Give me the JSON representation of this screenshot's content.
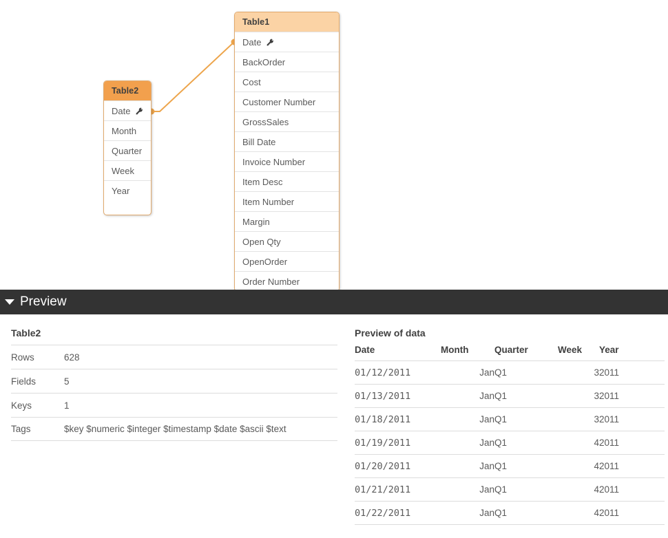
{
  "canvas": {
    "tables": [
      {
        "name": "Table1",
        "fields": [
          {
            "label": "Date",
            "key": true
          },
          {
            "label": "BackOrder",
            "key": false
          },
          {
            "label": "Cost",
            "key": false
          },
          {
            "label": "Customer Number",
            "key": false
          },
          {
            "label": "GrossSales",
            "key": false
          },
          {
            "label": "Bill Date",
            "key": false
          },
          {
            "label": "Invoice Number",
            "key": false
          },
          {
            "label": "Item Desc",
            "key": false
          },
          {
            "label": "Item Number",
            "key": false
          },
          {
            "label": "Margin",
            "key": false
          },
          {
            "label": "Open Qty",
            "key": false
          },
          {
            "label": "OpenOrder",
            "key": false
          },
          {
            "label": "Order Number",
            "key": false
          }
        ]
      },
      {
        "name": "Table2",
        "fields": [
          {
            "label": "Date",
            "key": true
          },
          {
            "label": "Month",
            "key": false
          },
          {
            "label": "Quarter",
            "key": false
          },
          {
            "label": "Week",
            "key": false
          },
          {
            "label": "Year",
            "key": false
          }
        ]
      }
    ],
    "association_color": "#eda54c",
    "header_colors": {
      "table1": "#fbd3a5",
      "table2": "#f2a04d"
    }
  },
  "preview_bar": {
    "title": "Preview",
    "expanded": true,
    "background": "#333333"
  },
  "table_info": {
    "heading": "Table2",
    "rows": [
      {
        "label": "Rows",
        "value": "628"
      },
      {
        "label": "Fields",
        "value": "5"
      },
      {
        "label": "Keys",
        "value": "1"
      },
      {
        "label": "Tags",
        "value": "$key $numeric $integer $timestamp $date $ascii $text"
      }
    ]
  },
  "data_preview": {
    "heading": "Preview of data",
    "columns": [
      "Date",
      "Month",
      "Quarter",
      "Week",
      "Year"
    ],
    "rows": [
      [
        "01/12/2011",
        "Jan",
        "Q1",
        "3",
        "2011"
      ],
      [
        "01/13/2011",
        "Jan",
        "Q1",
        "3",
        "2011"
      ],
      [
        "01/18/2011",
        "Jan",
        "Q1",
        "3",
        "2011"
      ],
      [
        "01/19/2011",
        "Jan",
        "Q1",
        "4",
        "2011"
      ],
      [
        "01/20/2011",
        "Jan",
        "Q1",
        "4",
        "2011"
      ],
      [
        "01/21/2011",
        "Jan",
        "Q1",
        "4",
        "2011"
      ],
      [
        "01/22/2011",
        "Jan",
        "Q1",
        "4",
        "2011"
      ]
    ]
  }
}
